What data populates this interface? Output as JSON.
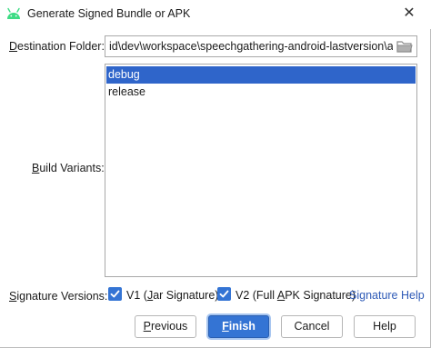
{
  "window": {
    "title": "Generate Signed Bundle or APK",
    "close_glyph": "✕",
    "app_icon": "android-icon"
  },
  "destination": {
    "label_underlined": "D",
    "label_rest": "estination Folder:",
    "value": "id\\dev\\workspace\\speechgathering-android-lastversion\\app",
    "browse_icon": "folder-icon"
  },
  "build_variants": {
    "label_underlined": "B",
    "label_rest": "uild Variants:",
    "items": [
      {
        "label": "debug",
        "selected": true
      },
      {
        "label": "release",
        "selected": false
      }
    ]
  },
  "signature": {
    "label_underlined": "S",
    "label_rest": "ignature Versions:",
    "v1": {
      "prefix": "V1 (",
      "underlined": "J",
      "rest": "ar Signature)",
      "checked": true
    },
    "v2": {
      "prefix": "V2 (Full ",
      "underlined": "A",
      "rest": "PK Signature)",
      "checked": true
    },
    "help_link": "Signature Help"
  },
  "buttons": {
    "previous": {
      "underlined": "P",
      "rest": "revious"
    },
    "finish": {
      "underlined": "F",
      "rest": "inish"
    },
    "cancel": "Cancel",
    "help": "Help"
  },
  "colors": {
    "accent": "#3474d4",
    "selection": "#2f65ca",
    "link": "#2f5bb7",
    "android_green": "#3ddc84"
  }
}
